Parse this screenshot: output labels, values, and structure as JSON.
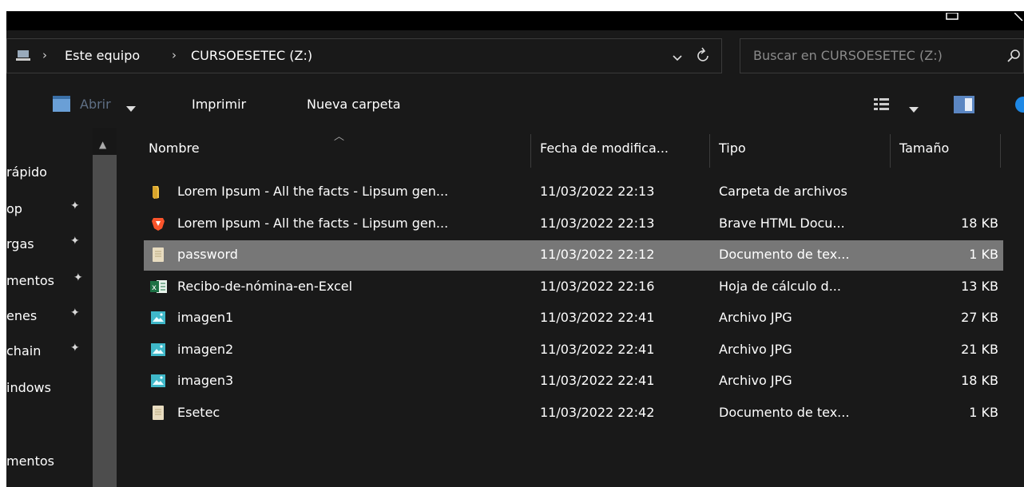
{
  "address": {
    "crumbs": [
      "Este equipo",
      "CURSOESETEC (Z:)"
    ],
    "search_placeholder": "Buscar en CURSOESETEC (Z:)"
  },
  "toolbar": {
    "open_label": "Abrir",
    "print_label": "Imprimir",
    "new_folder_label": "Nueva carpeta"
  },
  "sidebar": {
    "items": [
      {
        "label": "rápido"
      },
      {
        "label": "op"
      },
      {
        "label": "rgas"
      },
      {
        "label": "mentos"
      },
      {
        "label": "enes"
      },
      {
        "label": "chain"
      },
      {
        "label": "indows"
      },
      {
        "label": "mentos"
      }
    ]
  },
  "columns": {
    "name": "Nombre",
    "date": "Fecha de modifica...",
    "type": "Tipo",
    "size": "Tamaño"
  },
  "files": [
    {
      "name": "Lorem Ipsum - All the facts - Lipsum gen...",
      "date": "11/03/2022 22:13",
      "type": "Carpeta de archivos",
      "size": "",
      "icon": "folder-icon"
    },
    {
      "name": "Lorem Ipsum - All the facts - Lipsum gen...",
      "date": "11/03/2022 22:13",
      "type": "Brave HTML Docu...",
      "size": "18 KB",
      "icon": "brave-icon"
    },
    {
      "name": "password",
      "date": "11/03/2022 22:12",
      "type": "Documento de tex...",
      "size": "1 KB",
      "icon": "text-file-icon",
      "selected": true
    },
    {
      "name": "Recibo-de-nómina-en-Excel",
      "date": "11/03/2022 22:16",
      "type": "Hoja de cálculo d...",
      "size": "13 KB",
      "icon": "excel-icon"
    },
    {
      "name": "imagen1",
      "date": "11/03/2022 22:41",
      "type": "Archivo JPG",
      "size": "27 KB",
      "icon": "image-icon"
    },
    {
      "name": "imagen2",
      "date": "11/03/2022 22:41",
      "type": "Archivo JPG",
      "size": "21 KB",
      "icon": "image-icon"
    },
    {
      "name": "imagen3",
      "date": "11/03/2022 22:41",
      "type": "Archivo JPG",
      "size": "18 KB",
      "icon": "image-icon"
    },
    {
      "name": "Esetec",
      "date": "11/03/2022 22:42",
      "type": "Documento de tex...",
      "size": "1 KB",
      "icon": "text-file-icon"
    }
  ]
}
